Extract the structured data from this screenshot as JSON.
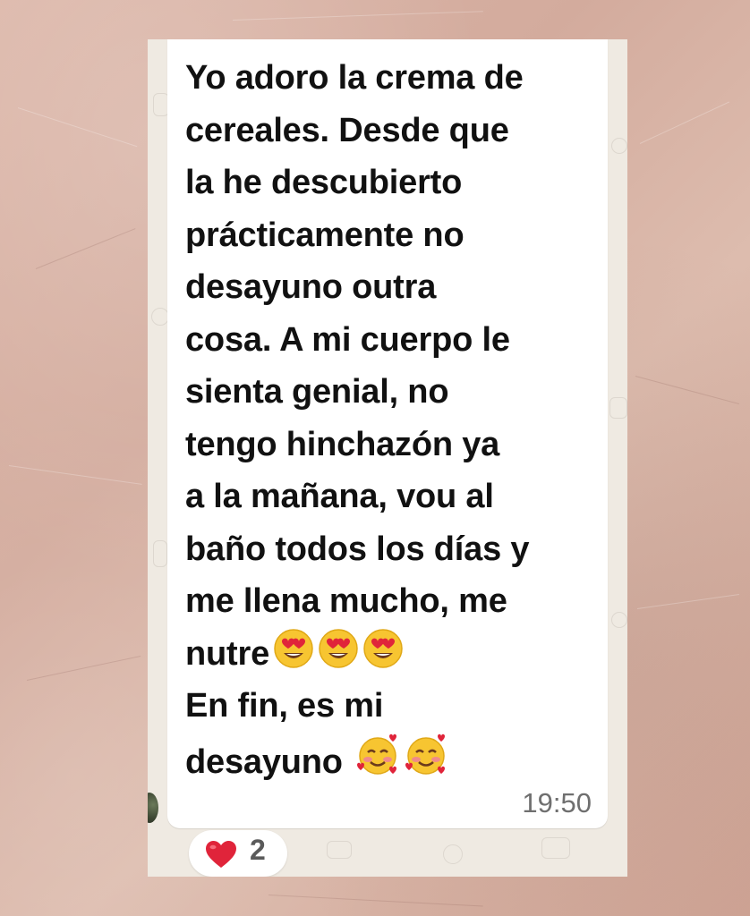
{
  "message": {
    "lines": [
      "Yo adoro la crema de",
      "cereales. Desde que",
      "la he descubierto",
      "prácticamente no",
      "desayuno outra",
      "cosa. A mi cuerpo le",
      "sienta genial, no",
      "tengo hinchazón ya",
      "a la mañana, vou al",
      "baño todos los días y",
      "me llena mucho, me",
      "nutre",
      "En fin, es mi",
      "desayuno"
    ],
    "emojis": {
      "line_12": [
        "heart-eyes-emoji",
        "heart-eyes-emoji",
        "heart-eyes-emoji"
      ],
      "line_14": [
        "smiling-face-with-hearts-emoji",
        "smiling-face-with-hearts-emoji"
      ]
    },
    "time": "19:50"
  },
  "reaction": {
    "emoji": "red-heart-icon",
    "count": "2"
  },
  "colors": {
    "bubble": "#ffffff",
    "chat_background": "#efeae2",
    "paper_background": "#d8b2a4",
    "text": "#111111",
    "timestamp": "#6f6f6f",
    "heart": "#e0243a",
    "emoji_face": "#f7c531"
  }
}
